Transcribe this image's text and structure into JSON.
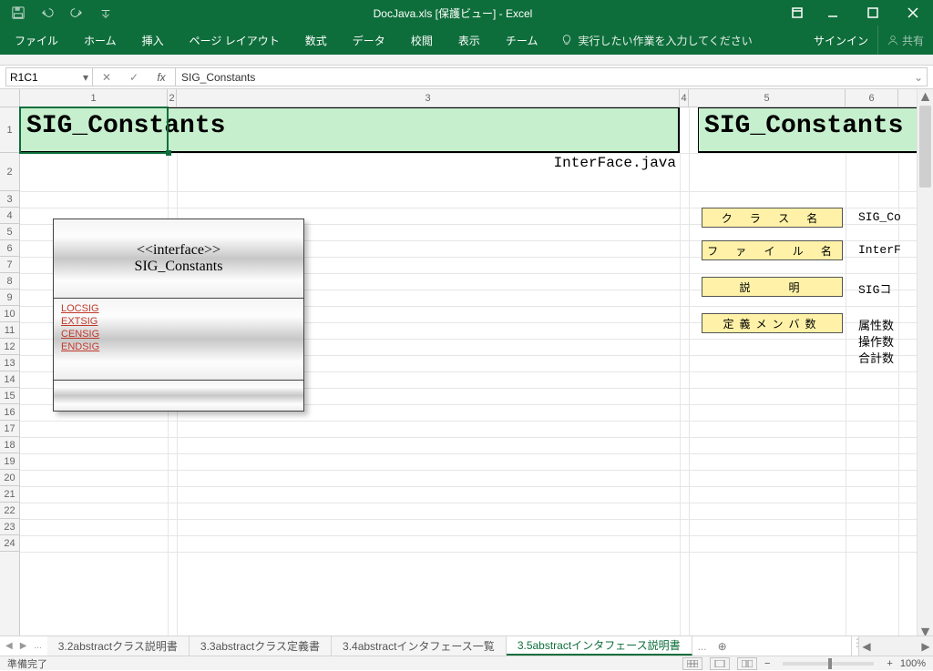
{
  "titlebar": {
    "title": "DocJava.xls  [保護ビュー] - Excel"
  },
  "ribbon": {
    "file": "ファイル",
    "tabs": [
      "ホーム",
      "挿入",
      "ページ レイアウト",
      "数式",
      "データ",
      "校閲",
      "表示",
      "チーム"
    ],
    "tell": "実行したい作業を入力してください",
    "signin": "サインイン",
    "share": "共有"
  },
  "fx": {
    "namebox": "R1C1",
    "formula": "SIG_Constants"
  },
  "col_headers": [
    "1",
    "2",
    "3",
    "4",
    "5",
    "6"
  ],
  "row_headers": [
    "1",
    "2",
    "3",
    "4",
    "5",
    "6",
    "7",
    "8",
    "9",
    "10",
    "11",
    "12",
    "13",
    "14",
    "15",
    "16",
    "17",
    "18",
    "19",
    "20",
    "21",
    "22",
    "23",
    "24"
  ],
  "cells": {
    "a1": "SIG_Constants",
    "e1": "SIG_Constants",
    "interface_file": "InterFace.java",
    "label_class": "ク ラ ス 名",
    "label_file": "フ ァ イ ル 名",
    "label_desc": "説　　明",
    "label_members": "定義メンバ数",
    "val_class": "SIG_Co",
    "val_file": "InterF",
    "val_desc": "SIGコ",
    "val_attr": "属性数",
    "val_op": "操作数",
    "val_total": "合計数"
  },
  "uml": {
    "stereotype": "<<interface>>",
    "name": "SIG_Constants",
    "members": [
      "LOCSIG",
      "EXTSIG",
      "CENSIG",
      "ENDSIG"
    ]
  },
  "sheet_tabs": {
    "items": [
      "3.2abstractクラス説明書",
      "3.3abstractクラス定義書",
      "3.4abstractインタフェース一覧",
      "3.5abstractインタフェース説明書"
    ],
    "active_index": 3,
    "more": "..."
  },
  "status": {
    "ready": "準備完了",
    "zoom": "100%"
  }
}
